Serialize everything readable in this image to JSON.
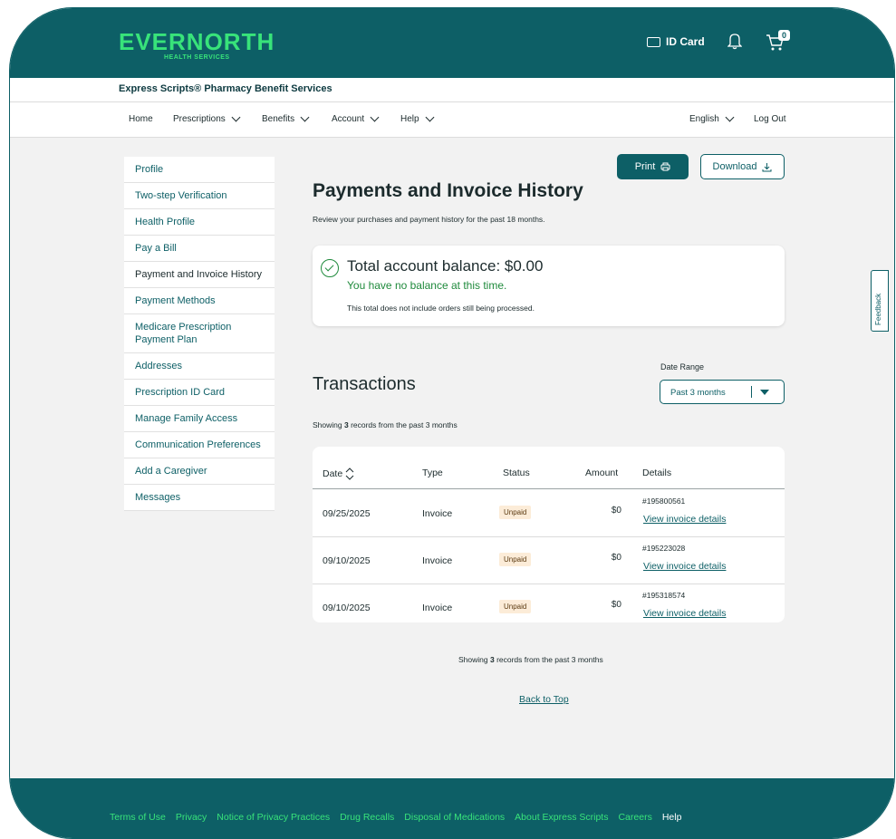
{
  "header": {
    "logo": "EVERNORTH",
    "logo_sub": "HEALTH SERVICES",
    "id_card": "ID Card",
    "cart_count": "0"
  },
  "brand": "Express Scripts® Pharmacy Benefit Services",
  "nav": {
    "items": [
      "Home",
      "Prescriptions",
      "Benefits",
      "Account",
      "Help"
    ],
    "language": "English",
    "logout": "Log Out"
  },
  "sidebar": {
    "items": [
      {
        "label": "Profile"
      },
      {
        "label": "Two-step Verification"
      },
      {
        "label": "Health Profile"
      },
      {
        "label": "Pay a Bill"
      },
      {
        "label": "Payment and Invoice History"
      },
      {
        "label": "Payment Methods"
      },
      {
        "label": "Medicare Prescription Payment Plan"
      },
      {
        "label": "Addresses"
      },
      {
        "label": "Prescription ID Card"
      },
      {
        "label": "Manage Family Access"
      },
      {
        "label": "Communication Preferences"
      },
      {
        "label": "Add a Caregiver"
      },
      {
        "label": "Messages"
      }
    ]
  },
  "actions": {
    "print": "Print",
    "download": "Download"
  },
  "page": {
    "title": "Payments and Invoice History",
    "subtitle": "Review your purchases and payment history for the past 18 months."
  },
  "balance": {
    "title": "Total account balance: $0.00",
    "message": "You have no balance at this time.",
    "note": "This total does not include orders still being processed."
  },
  "transactions": {
    "title": "Transactions",
    "date_range_label": "Date Range",
    "date_range_value": "Past 3 months",
    "showing_prefix": "Showing ",
    "showing_count": "3",
    "showing_suffix": " records from the past 3 months",
    "columns": [
      "Date",
      "Type",
      "Status",
      "Amount",
      "Details"
    ],
    "rows": [
      {
        "date": "09/25/2025",
        "type": "Invoice",
        "status": "Unpaid",
        "amount": "$0",
        "invoice": "#195800561",
        "link": "View invoice details"
      },
      {
        "date": "09/10/2025",
        "type": "Invoice",
        "status": "Unpaid",
        "amount": "$0",
        "invoice": "#195223028",
        "link": "View invoice details"
      },
      {
        "date": "09/10/2025",
        "type": "Invoice",
        "status": "Unpaid",
        "amount": "$0",
        "invoice": "#195318574",
        "link": "View invoice details"
      }
    ]
  },
  "back_to_top": "Back to Top",
  "feedback": "Feedback",
  "footer": {
    "links": [
      "Terms of Use",
      "Privacy",
      "Notice of Privacy Practices",
      "Drug Recalls",
      "Disposal of Medications",
      "About Express Scripts",
      "Careers"
    ],
    "help": "Help"
  },
  "colors": {
    "primary": "#0d5f66",
    "accent": "#38e37a",
    "success": "#1f8a3c",
    "badge_bg": "#fcecd8"
  }
}
